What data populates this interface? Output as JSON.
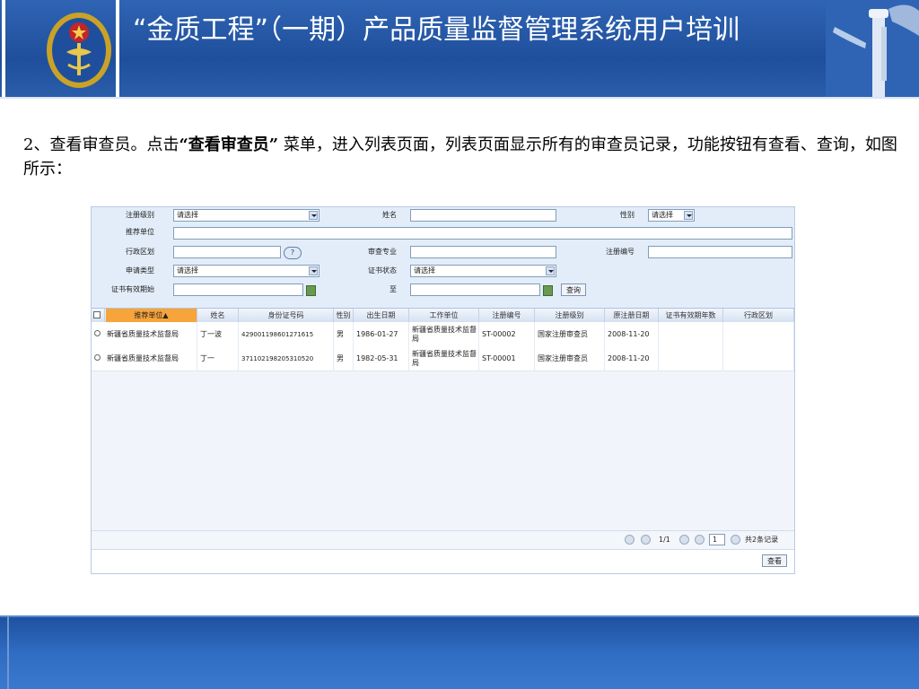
{
  "slide": {
    "title": "“金质工程”（一期）产品质量监督管理系统用户培训",
    "intro_prefix": "2、查看审查员。点击",
    "intro_emphasis": "“查看审查员”",
    "intro_suffix": " 菜单，进入列表页面，列表页面显示所有的审查员记录，功能按钮有查看、查询，如图所示："
  },
  "form": {
    "reg_level_label": "注册级别",
    "reg_level_value": "请选择",
    "name_label": "姓名",
    "gender_label": "性别",
    "gender_value": "请选择",
    "rec_unit_label": "推荐单位",
    "admin_region_label": "行政区划",
    "review_major_label": "审查专业",
    "reg_no_label": "注册编号",
    "apply_type_label": "申请类型",
    "apply_type_value": "请选择",
    "cert_status_label": "证书状态",
    "cert_status_value": "请选择",
    "cert_valid_start_label": "证书有效期始",
    "to_label": "至",
    "query_button": "查询"
  },
  "grid": {
    "columns": [
      "推荐单位▲",
      "姓名",
      "身份证号码",
      "性别",
      "出生日期",
      "工作单位",
      "注册编号",
      "注册级别",
      "原注册日期",
      "证书有效期年数",
      "行政区划"
    ],
    "rows": [
      [
        "新疆省质量技术监督局",
        "丁一波",
        "429001198601271615",
        "男",
        "1986-01-27",
        "新疆省质量技术监督局",
        "ST-00002",
        "国家注册审查员",
        "2008-11-20",
        "",
        ""
      ],
      [
        "新疆省质量技术监督局",
        "丁一",
        "371102198205310520",
        "男",
        "1982-05-31",
        "新疆省质量技术监督局",
        "ST-00001",
        "国家注册审查员",
        "2008-11-20",
        "",
        ""
      ]
    ]
  },
  "pager": {
    "page_info": "1/1",
    "page_input": "1",
    "total": "共2条记录"
  },
  "actions": {
    "view_button": "查看"
  }
}
